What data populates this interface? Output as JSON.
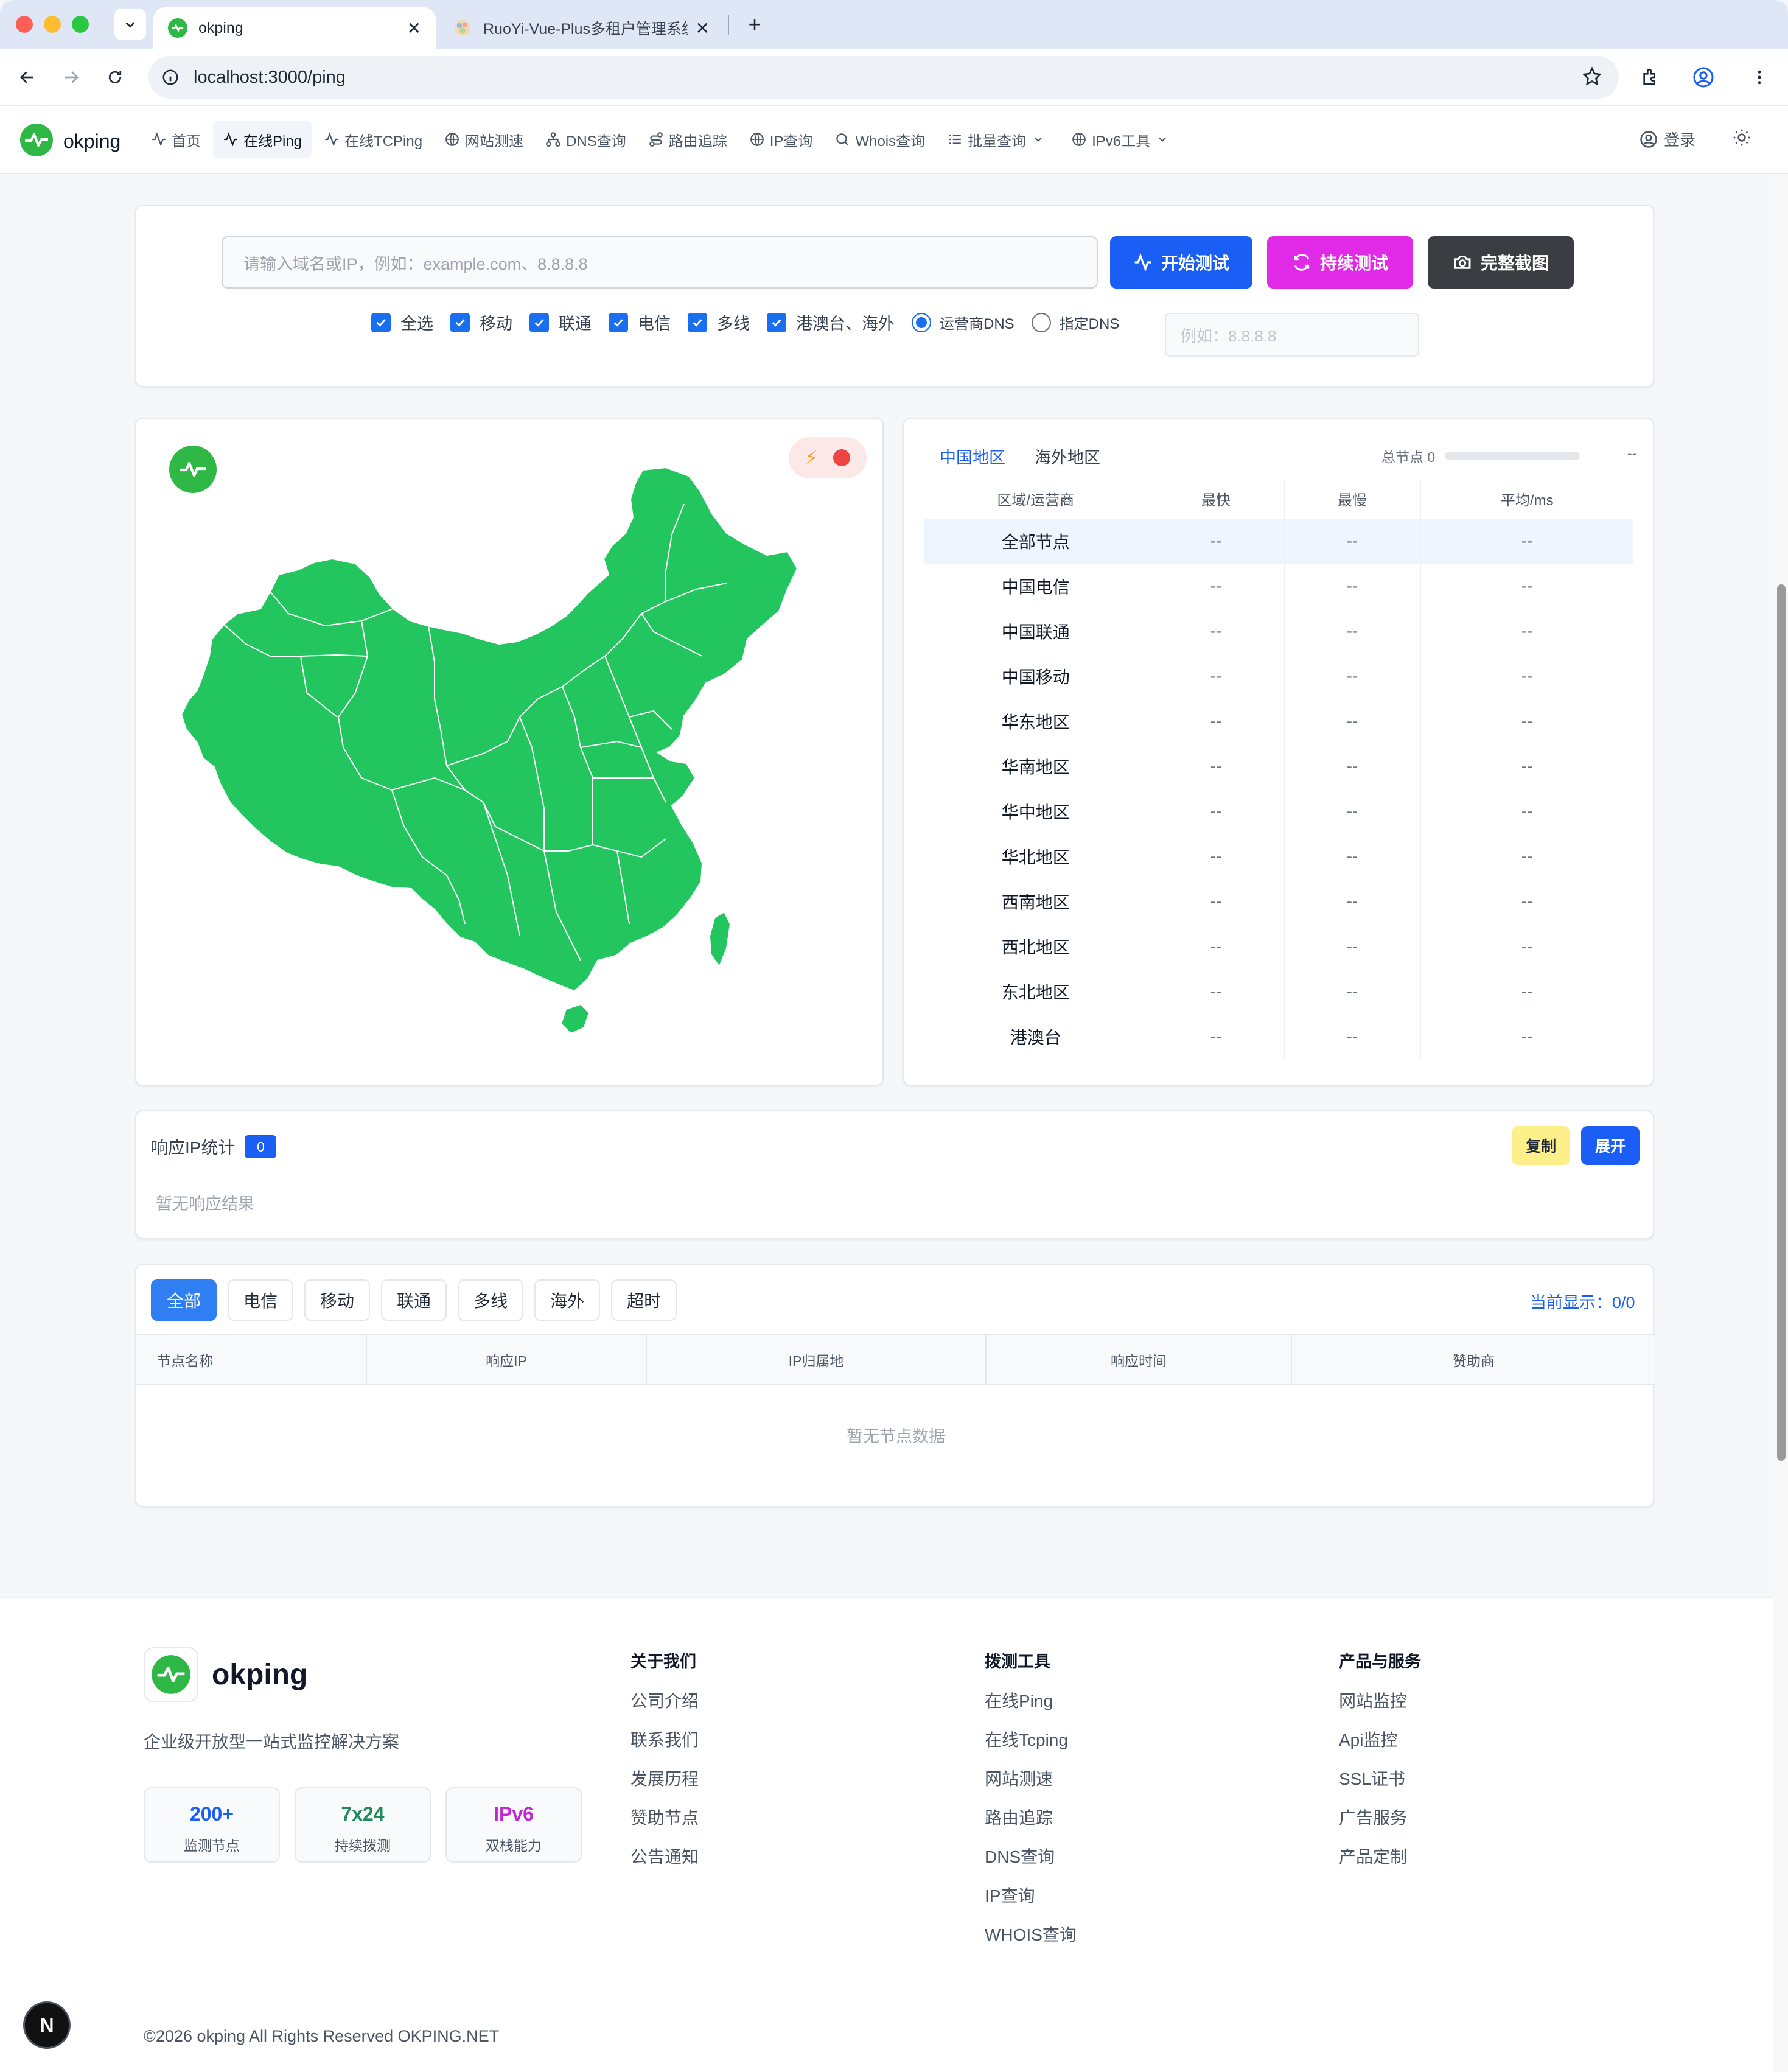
{
  "browser": {
    "tabs": [
      {
        "title": "okping",
        "active": true
      },
      {
        "title": "RuoYi-Vue-Plus多租户管理系统",
        "active": false
      }
    ],
    "url": "localhost:3000/ping"
  },
  "header": {
    "brand": "okping",
    "nav": [
      {
        "label": "首页",
        "icon": "activity-icon"
      },
      {
        "label": "在线Ping",
        "icon": "activity-icon",
        "active": true
      },
      {
        "label": "在线TCPing",
        "icon": "activity-icon"
      },
      {
        "label": "网站测速",
        "icon": "globe-icon"
      },
      {
        "label": "DNS查询",
        "icon": "network-icon"
      },
      {
        "label": "路由追踪",
        "icon": "route-icon"
      },
      {
        "label": "IP查询",
        "icon": "globe-icon"
      },
      {
        "label": "Whois查询",
        "icon": "search-icon"
      },
      {
        "label": "批量查询",
        "icon": "list-icon",
        "dropdown": true
      },
      {
        "label": "IPv6工具",
        "icon": "globe-icon",
        "dropdown": true
      }
    ],
    "login": "登录"
  },
  "search": {
    "placeholder": "请输入域名或IP，例如：example.com、8.8.8.8",
    "start_btn": "开始测试",
    "continuous_btn": "持续测试",
    "screenshot_btn": "完整截图",
    "options": [
      "全选",
      "移动",
      "联通",
      "电信",
      "多线",
      "港澳台、海外"
    ],
    "dns_operator": "运营商DNS",
    "dns_custom": "指定DNS",
    "dns_placeholder": "例如：8.8.8.8"
  },
  "regions": {
    "tabs": [
      "中国地区",
      "海外地区"
    ],
    "total_label": "总节点 0",
    "total_value": "--",
    "columns": [
      "区域/运营商",
      "最快",
      "最慢",
      "平均/ms"
    ],
    "rows": [
      {
        "name": "全部节点",
        "fast": "--",
        "slow": "--",
        "avg": "--"
      },
      {
        "name": "中国电信",
        "fast": "--",
        "slow": "--",
        "avg": "--"
      },
      {
        "name": "中国联通",
        "fast": "--",
        "slow": "--",
        "avg": "--"
      },
      {
        "name": "中国移动",
        "fast": "--",
        "slow": "--",
        "avg": "--"
      },
      {
        "name": "华东地区",
        "fast": "--",
        "slow": "--",
        "avg": "--"
      },
      {
        "name": "华南地区",
        "fast": "--",
        "slow": "--",
        "avg": "--"
      },
      {
        "name": "华中地区",
        "fast": "--",
        "slow": "--",
        "avg": "--"
      },
      {
        "name": "华北地区",
        "fast": "--",
        "slow": "--",
        "avg": "--"
      },
      {
        "name": "西南地区",
        "fast": "--",
        "slow": "--",
        "avg": "--"
      },
      {
        "name": "西北地区",
        "fast": "--",
        "slow": "--",
        "avg": "--"
      },
      {
        "name": "东北地区",
        "fast": "--",
        "slow": "--",
        "avg": "--"
      },
      {
        "name": "港澳台",
        "fast": "--",
        "slow": "--",
        "avg": "--"
      }
    ]
  },
  "ipstats": {
    "title": "响应IP统计",
    "count": "0",
    "copy": "复制",
    "expand": "展开",
    "empty": "暂无响应结果"
  },
  "nodes": {
    "filters": [
      "全部",
      "电信",
      "移动",
      "联通",
      "多线",
      "海外",
      "超时"
    ],
    "current": "当前显示：0/0",
    "columns": [
      "节点名称",
      "响应IP",
      "IP归属地",
      "响应时间",
      "赞助商"
    ],
    "empty": "暂无节点数据"
  },
  "footer": {
    "brand": "okping",
    "desc": "企业级开放型一站式监控解决方案",
    "stats": [
      {
        "value": "200+",
        "label": "监测节点",
        "color": "#1a5ef5"
      },
      {
        "value": "7x24",
        "label": "持续拨测",
        "color": "#1f8a5b"
      },
      {
        "value": "IPv6",
        "label": "双栈能力",
        "color": "#c026d3"
      }
    ],
    "cols": [
      {
        "title": "关于我们",
        "items": [
          "公司介绍",
          "联系我们",
          "发展历程",
          "赞助节点",
          "公告通知"
        ]
      },
      {
        "title": "拨测工具",
        "items": [
          "在线Ping",
          "在线Tcping",
          "网站测速",
          "路由追踪",
          "DNS查询",
          "IP查询",
          "WHOIS查询"
        ]
      },
      {
        "title": "产品与服务",
        "items": [
          "网站监控",
          "Api监控",
          "SSL证书",
          "广告服务",
          "产品定制"
        ]
      }
    ],
    "copyright": "©2026 okping All Rights Reserved OKPING.NET"
  },
  "dev_badge": "N",
  "colors": {
    "primary": "#1a5ef5",
    "accent_pink": "#e02ae7",
    "map_green": "#22c55e",
    "brand_green": "#2fb845"
  }
}
